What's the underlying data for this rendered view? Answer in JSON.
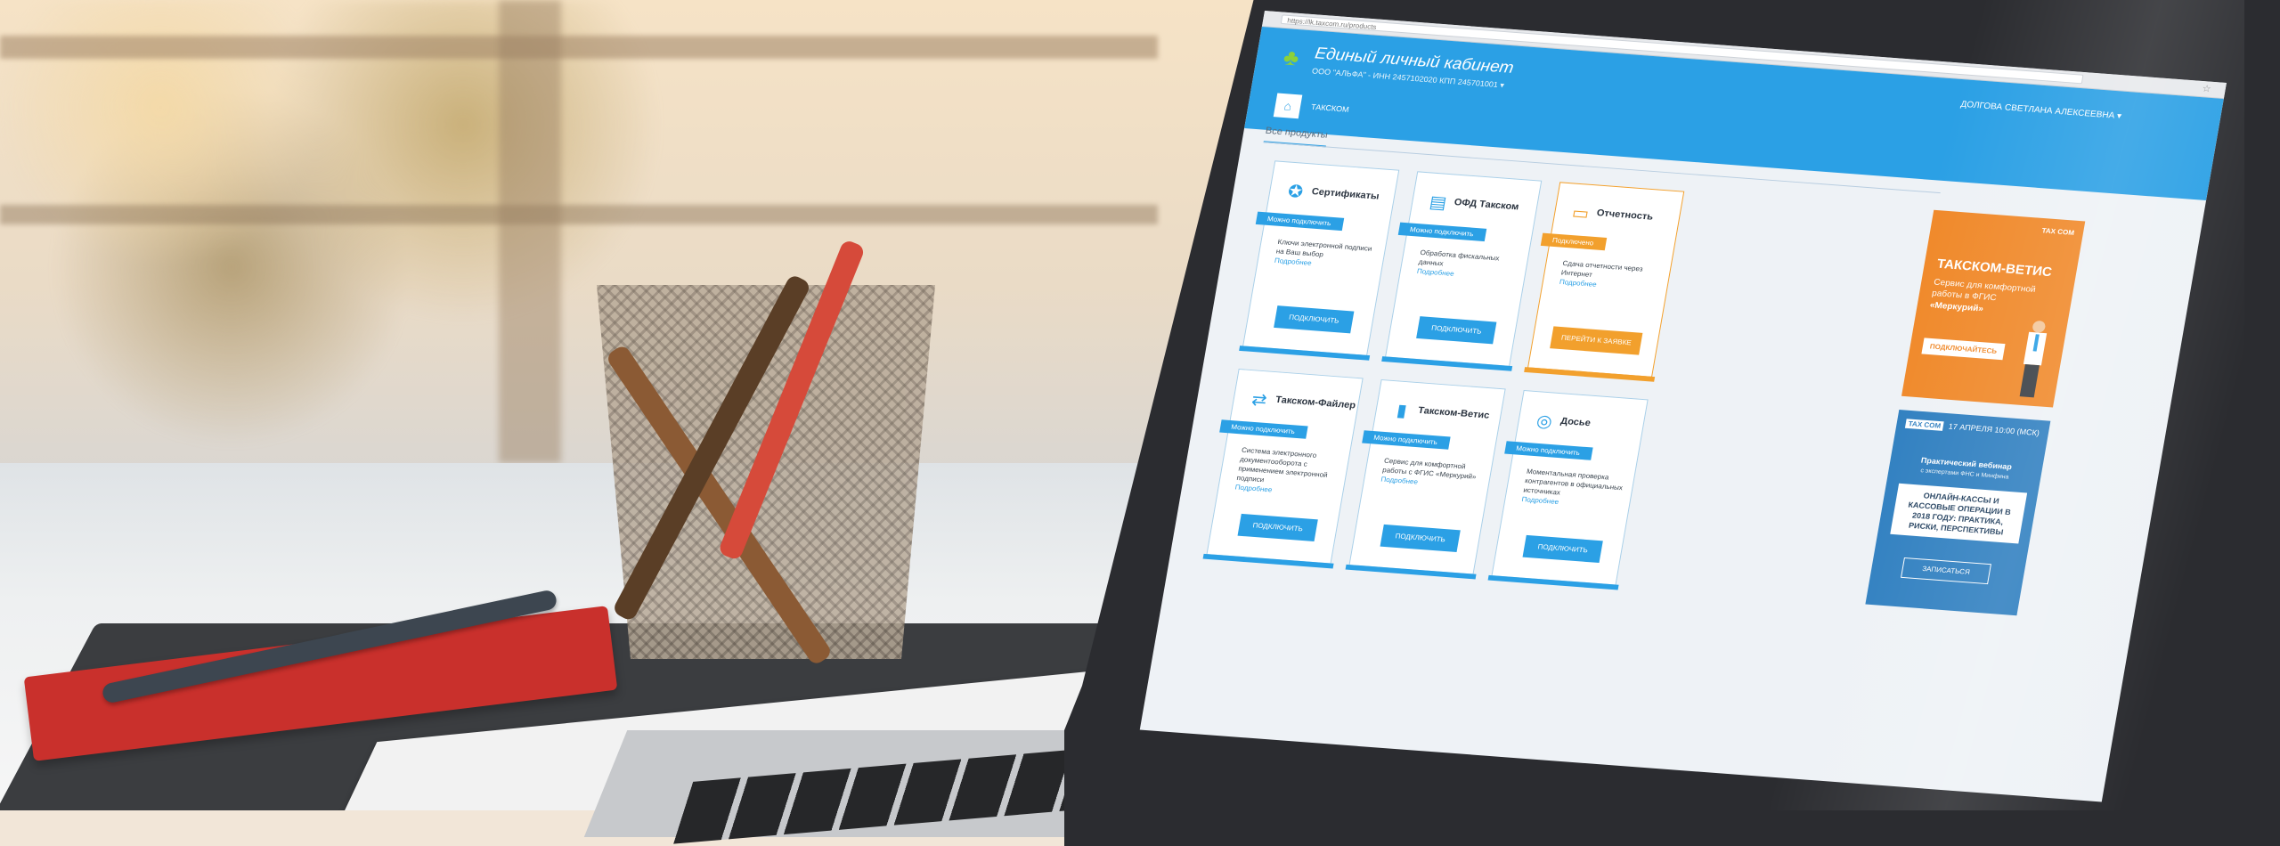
{
  "browser": {
    "address": "https://lk.taxcom.ru/products"
  },
  "header": {
    "title": "Единый личный кабинет",
    "subtitle": "ООО \"АЛЬФА\" - ИНН 2457102020 КПП 245701001 ▾",
    "user": "ДОЛГОВА СВЕТЛАНА АЛЕКСЕЕВНА ▾",
    "nav_home_icon": "home-icon",
    "nav_link": "ТАКСКОМ"
  },
  "subnav": {
    "tab": "Все продукты"
  },
  "colors": {
    "accent": "#2ba0e5",
    "orange": "#f2a02d",
    "promo_orange": "#f0892a",
    "promo_blue": "#2f7fc0"
  },
  "cards": [
    {
      "icon": "certificate-icon",
      "title": "Сертификаты",
      "status": "Можно подключить",
      "desc": "Ключи электронной подписи на Ваш выбор",
      "more": "Подробнее",
      "button": "ПОДКЛЮЧИТЬ"
    },
    {
      "icon": "cash-register-icon",
      "title": "ОФД Такском",
      "status": "Можно подключить",
      "desc": "Обработка фискальных данных",
      "more": "Подробнее",
      "button": "ПОДКЛЮЧИТЬ"
    },
    {
      "icon": "monitor-icon",
      "title": "Отчетность",
      "status": "Подключено",
      "desc": "Сдача отчетности через Интернет",
      "more": "Подробнее",
      "button": "ПЕРЕЙТИ К ЗАЯВКЕ"
    },
    {
      "icon": "file-exchange-icon",
      "title": "Такском-Файлер",
      "status": "Можно подключить",
      "desc": "Система электронного документооборота с применением электронной подписи",
      "more": "Подробнее",
      "button": "ПОДКЛЮЧИТЬ"
    },
    {
      "icon": "document-icon",
      "title": "Такском-Ветис",
      "status": "Можно подключить",
      "desc": "Сервис для комфортной работы с ФГИС «Меркурий»",
      "more": "Подробнее",
      "button": "ПОДКЛЮЧИТЬ"
    },
    {
      "icon": "dossier-icon",
      "title": "Досье",
      "status": "Можно подключить",
      "desc": "Моментальная проверка контрагентов в официальных источниках",
      "more": "Подробнее",
      "button": "ПОДКЛЮЧИТЬ"
    }
  ],
  "promo_vetis": {
    "brand": "TAX COM",
    "title": "ТАКСКОМ-ВЕТИС",
    "text": "Сервис для комфортной работы в ФГИС",
    "strong": "«Меркурий»",
    "button": "ПОДКЛЮЧАЙТЕСЬ"
  },
  "promo_webinar": {
    "brand": "TAX COM",
    "date": "17 АПРЕЛЯ 10:00 (МСК)",
    "title": "Практический вебинар",
    "subtitle": "с экспертами ФНС и Минфина",
    "box": "ОНЛАЙН-КАССЫ И КАССОВЫЕ ОПЕРАЦИИ В 2018 ГОДУ: ПРАКТИКА, РИСКИ, ПЕРСПЕКТИВЫ",
    "button": "ЗАПИСАТЬСЯ"
  }
}
